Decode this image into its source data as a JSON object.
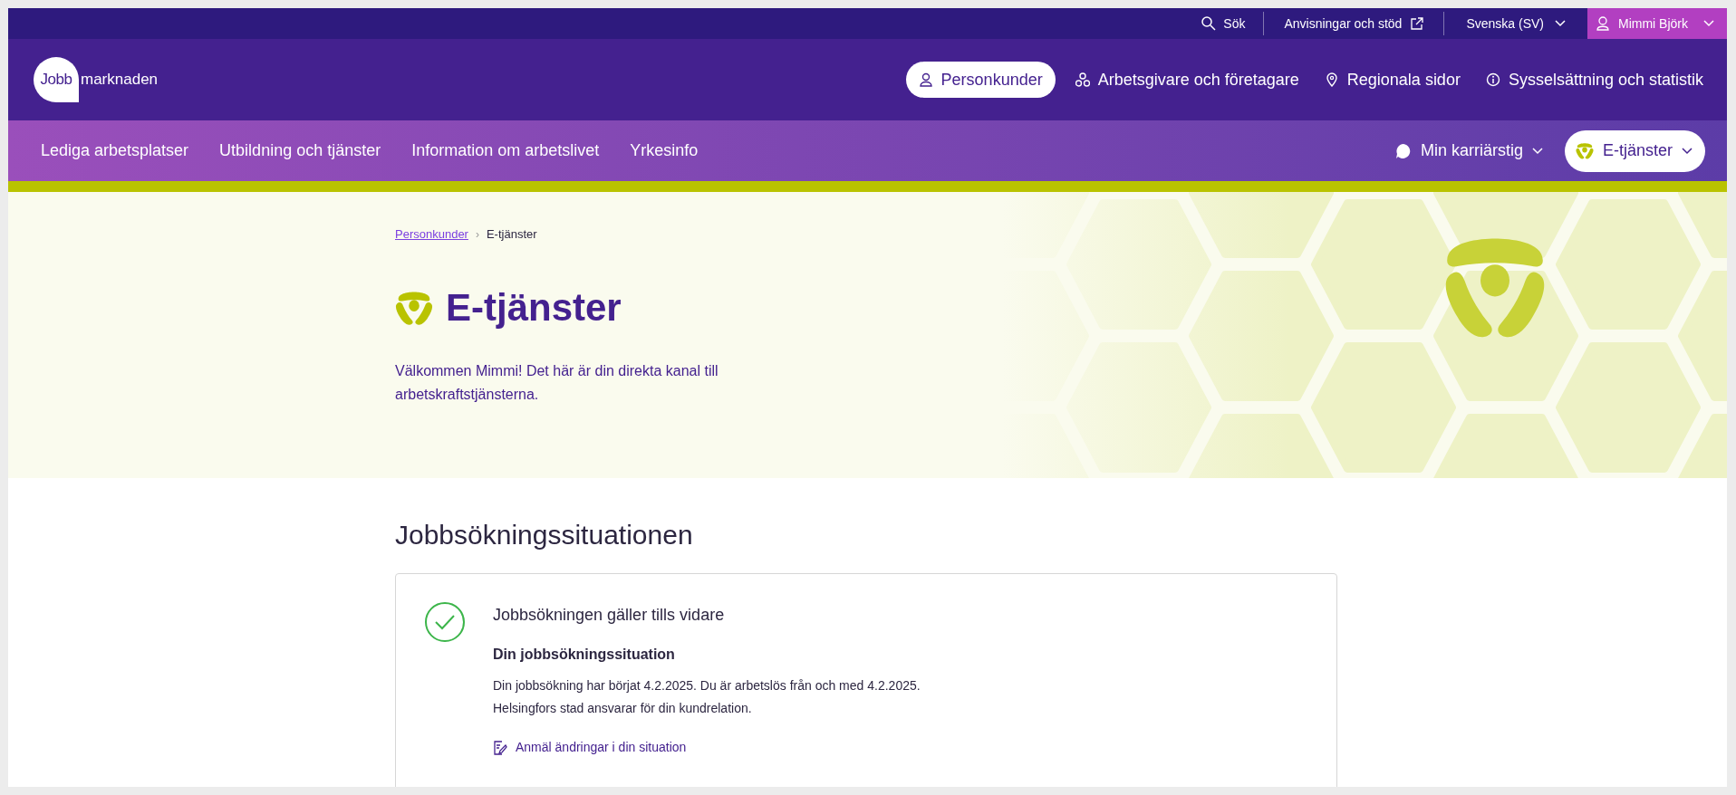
{
  "utility_bar": {
    "items": [
      {
        "kind": "search",
        "label": "Sök"
      },
      {
        "kind": "external",
        "label": "Anvisningar och stöd"
      },
      {
        "kind": "dropdown",
        "label": "Svenska (SV)"
      },
      {
        "kind": "user",
        "label": "Mimmi Björk"
      }
    ]
  },
  "header": {
    "logo": {
      "part_1": "Jobb",
      "part_2": "marknaden"
    },
    "audience_tabs": [
      {
        "kind": "person",
        "label": "Personkunder",
        "selected": true
      },
      {
        "kind": "network",
        "label": "Arbetsgivare och företagare",
        "selected": false
      },
      {
        "kind": "pin",
        "label": "Regionala sidor",
        "selected": false
      },
      {
        "kind": "info",
        "label": "Sysselsättning och statistik",
        "selected": false
      }
    ]
  },
  "main_nav": {
    "items": [
      "Lediga arbetsplatser",
      "Utbildning och tjänster",
      "Information om arbetslivet",
      "Yrkesinfo"
    ],
    "right_items": [
      {
        "kind": "bubble",
        "label": "Min karriärstig",
        "highlighted": false
      },
      {
        "kind": "eservices",
        "label": "E-tjänster",
        "highlighted": true
      }
    ]
  },
  "hero": {
    "breadcrumb": [
      {
        "label": "Personkunder",
        "link": true
      },
      {
        "label": "E-tjänster",
        "link": false
      }
    ],
    "separator": "›",
    "title": "E-tjänster",
    "intro": "Välkommen Mimmi! Det här är din direkta kanal till arbetskraftstjänsterna."
  },
  "section": {
    "title": "Jobbsökningssituationen",
    "card": {
      "status_ok": true,
      "headline": "Jobbsökningen gäller tills vidare",
      "subheading": "Din jobbsökningssituation",
      "lines": [
        "Din jobbsökning har börjat 4.2.2025. Du är arbetslös från och med 4.2.2025.",
        "Helsingfors stad ansvarar för din kundrelation."
      ],
      "link": "Anmäl ändringar i din situation"
    }
  }
}
